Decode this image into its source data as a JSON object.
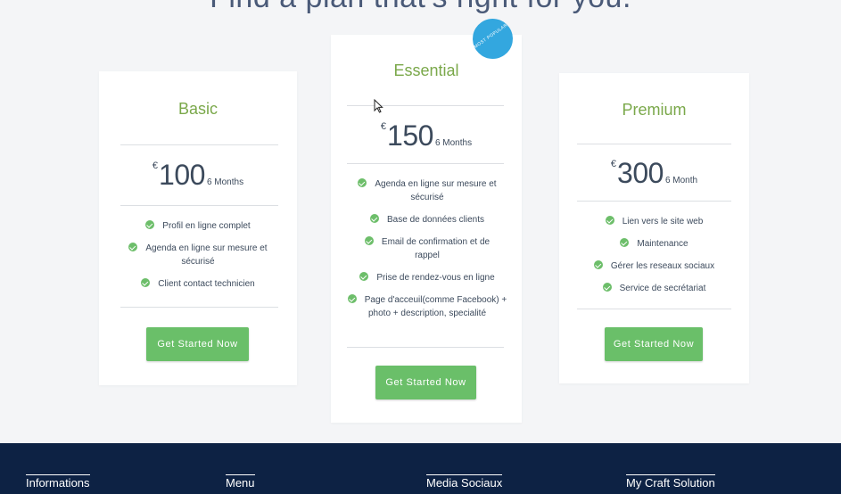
{
  "heading": "Find a plan that's right for you.",
  "badge": {
    "text": "MOST POPULAR"
  },
  "plans": [
    {
      "name": "Basic",
      "currency": "€",
      "amount": "100",
      "period": "6 Months",
      "features": [
        "Profil en ligne complet",
        "Agenda en ligne sur mesure et sécurisé",
        "Client contact technicien"
      ],
      "cta": "Get Started Now"
    },
    {
      "name": "Essential",
      "currency": "€",
      "amount": "150",
      "period": "6 Months",
      "features": [
        "Agenda en ligne sur mesure et sécurisé",
        "Base de données clients",
        "Email de confirmation et de rappel",
        "Prise de rendez-vous en ligne",
        "Page d'acceuil(comme Facebook) + photo + description, specialité"
      ],
      "cta": "Get Started Now"
    },
    {
      "name": "Premium",
      "currency": "€",
      "amount": "300",
      "period": "6 Month",
      "features": [
        "Lien vers le site web",
        "Maintenance",
        "Gérer les reseaux sociaux",
        "Service de secrétariat"
      ],
      "cta": "Get Started Now"
    }
  ],
  "footer": {
    "columns": [
      "Informations",
      "Menu",
      "Media Sociaux",
      "My Craft Solution"
    ]
  },
  "colors": {
    "accent_green": "#7aa84a",
    "button_green": "#6abf69",
    "badge_blue": "#33a7df",
    "footer_navy": "#0d2244"
  }
}
